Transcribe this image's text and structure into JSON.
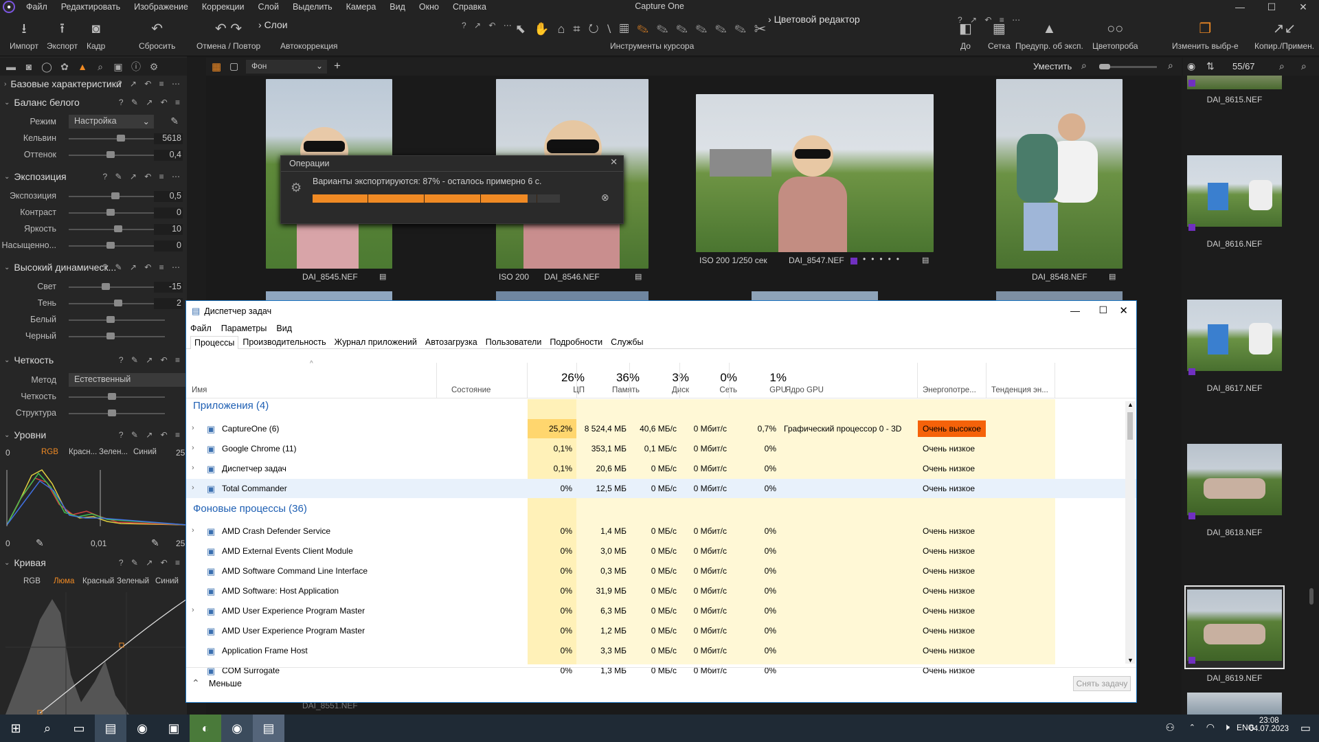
{
  "menu": {
    "items": [
      "Файл",
      "Редактировать",
      "Изображение",
      "Коррекции",
      "Слой",
      "Выделить",
      "Камера",
      "Вид",
      "Окно",
      "Справка"
    ],
    "app_title": "Capture One"
  },
  "toolbar": {
    "import": "Импорт",
    "export": "Экспорт",
    "frame": "Кадр",
    "reset": "Сбросить",
    "undo_redo": "Отмена / Повтор",
    "layers": "Слои",
    "autocorrection": "Автокоррекция",
    "cursor_tools": "Инструменты курсора",
    "color_editor": "Цветовой редактор",
    "before": "До",
    "grid": "Сетка",
    "exposure_warning": "Предупр. об эксп.",
    "proofing": "Цветопроба",
    "change_selection": "Изменить выбр-е",
    "copy_apply": "Копир./Примен."
  },
  "viewbar": {
    "layer_select": "Фон",
    "fit": "Уместить",
    "counter": "55/67"
  },
  "left": {
    "basic": "Базовые характеристики",
    "wb": {
      "title": "Баланс белого",
      "mode_label": "Режим",
      "mode_value": "Настройка",
      "kelvin_label": "Кельвин",
      "kelvin_value": "5618",
      "tint_label": "Оттенок",
      "tint_value": "0,4"
    },
    "exposure": {
      "title": "Экспозиция",
      "rows": [
        {
          "label": "Экспозиция",
          "value": "0,5"
        },
        {
          "label": "Контраст",
          "value": "0"
        },
        {
          "label": "Яркость",
          "value": "10"
        },
        {
          "label": "Насыщенно...",
          "value": "0"
        }
      ]
    },
    "hdr": {
      "title": "Высокий динамическ...",
      "rows": [
        {
          "label": "Свет",
          "value": "-15"
        },
        {
          "label": "Тень",
          "value": "2"
        },
        {
          "label": "Белый",
          "value": ""
        },
        {
          "label": "Черный",
          "value": ""
        }
      ]
    },
    "clarity": {
      "title": "Четкость",
      "method_label": "Метод",
      "method_value": "Естественный",
      "rows": [
        {
          "label": "Четкость",
          "value": ""
        },
        {
          "label": "Структура",
          "value": ""
        }
      ]
    },
    "levels": {
      "title": "Уровни",
      "left_val": "0",
      "right_val": "25",
      "tabs": [
        "RGB",
        "Красн...",
        "Зелен...",
        "Синий"
      ],
      "bottom_left": "0",
      "bottom_mid": "0,01",
      "bottom_right": "25"
    },
    "curve": {
      "title": "Кривая",
      "tabs": [
        "RGB",
        "Люма",
        "Красный",
        "Зеленый",
        "Синий"
      ]
    }
  },
  "thumbs": [
    {
      "name": "DAI_8545.NEF",
      "meta": ""
    },
    {
      "name": "DAI_8546.NEF",
      "meta": "ISO 200"
    },
    {
      "name": "DAI_8547.NEF",
      "meta": "ISO 200   1/250 сек"
    },
    {
      "name": "DAI_8548.NEF",
      "meta": ""
    }
  ],
  "strip": [
    "DAI_8615.NEF",
    "DAI_8616.NEF",
    "DAI_8617.NEF",
    "DAI_8618.NEF",
    "DAI_8619.NEF"
  ],
  "hidden_caption": "DAI_8551.NEF",
  "ops": {
    "title": "Операции",
    "message": "Варианты экспортируются: 87% - осталось примерно 6 с.",
    "progress": 0.87
  },
  "tm": {
    "title": "Диспетчер задач",
    "menu": [
      "Файл",
      "Параметры",
      "Вид"
    ],
    "tabs": [
      "Процессы",
      "Производительность",
      "Журнал приложений",
      "Автозагрузка",
      "Пользователи",
      "Подробности",
      "Службы"
    ],
    "headers": {
      "name": "Имя",
      "state": "Состояние",
      "cpu_pct": "26%",
      "cpu": "ЦП",
      "mem_pct": "36%",
      "mem": "Память",
      "disk_pct": "3%",
      "disk": "Диск",
      "net_pct": "0%",
      "net": "Сеть",
      "gpu_pct": "1%",
      "gpu": "GPU",
      "gpu_core": "Ядро GPU",
      "power": "Энергопотре...",
      "power_trend": "Тенденция эн..."
    },
    "apps_group": "Приложения (4)",
    "bg_group": "Фоновые процессы (36)",
    "apps": [
      {
        "name": "CaptureOne (6)",
        "cpu": "25,2%",
        "mem": "8 524,4 МБ",
        "disk": "40,6 МБ/с",
        "net": "0 Мбит/с",
        "gpu": "0,7%",
        "gpucore": "Графический процессор 0 - 3D",
        "power": "Очень высокое"
      },
      {
        "name": "Google Chrome (11)",
        "cpu": "0,1%",
        "mem": "353,1 МБ",
        "disk": "0,1 МБ/с",
        "net": "0 Мбит/с",
        "gpu": "0%",
        "gpucore": "",
        "power": "Очень низкое"
      },
      {
        "name": "Диспетчер задач",
        "cpu": "0,1%",
        "mem": "20,6 МБ",
        "disk": "0 МБ/с",
        "net": "0 Мбит/с",
        "gpu": "0%",
        "gpucore": "",
        "power": "Очень низкое"
      },
      {
        "name": "Total Commander",
        "cpu": "0%",
        "mem": "12,5 МБ",
        "disk": "0 МБ/с",
        "net": "0 Мбит/с",
        "gpu": "0%",
        "gpucore": "",
        "power": "Очень низкое"
      }
    ],
    "bg": [
      {
        "name": "AMD Crash Defender Service",
        "cpu": "0%",
        "mem": "1,4 МБ",
        "disk": "0 МБ/с",
        "net": "0 Мбит/с",
        "gpu": "0%",
        "power": "Очень низкое"
      },
      {
        "name": "AMD External Events Client Module",
        "cpu": "0%",
        "mem": "3,0 МБ",
        "disk": "0 МБ/с",
        "net": "0 Мбит/с",
        "gpu": "0%",
        "power": "Очень низкое"
      },
      {
        "name": "AMD Software Command Line Interface",
        "cpu": "0%",
        "mem": "0,3 МБ",
        "disk": "0 МБ/с",
        "net": "0 Мбит/с",
        "gpu": "0%",
        "power": "Очень низкое"
      },
      {
        "name": "AMD Software: Host Application",
        "cpu": "0%",
        "mem": "31,9 МБ",
        "disk": "0 МБ/с",
        "net": "0 Мбит/с",
        "gpu": "0%",
        "power": "Очень низкое"
      },
      {
        "name": "AMD User Experience Program Master",
        "cpu": "0%",
        "mem": "6,3 МБ",
        "disk": "0 МБ/с",
        "net": "0 Мбит/с",
        "gpu": "0%",
        "power": "Очень низкое"
      },
      {
        "name": "AMD User Experience Program Master",
        "cpu": "0%",
        "mem": "1,2 МБ",
        "disk": "0 МБ/с",
        "net": "0 Мбит/с",
        "gpu": "0%",
        "power": "Очень низкое"
      },
      {
        "name": "Application Frame Host",
        "cpu": "0%",
        "mem": "3,3 МБ",
        "disk": "0 МБ/с",
        "net": "0 Мбит/с",
        "gpu": "0%",
        "power": "Очень низкое"
      },
      {
        "name": "COM Surrogate",
        "cpu": "0%",
        "mem": "1,3 МБ",
        "disk": "0 МБ/с",
        "net": "0 Мбит/с",
        "gpu": "0%",
        "power": "Очень низкое"
      }
    ],
    "less": "Меньше",
    "end_task": "Снять задачу"
  },
  "taskbar": {
    "lang": "ENG",
    "time": "23:08",
    "date": "04.07.2023"
  },
  "colors": {
    "accent": "#f08a24",
    "power_high": "#f5620a",
    "tm_yellow": "#fff4c4"
  }
}
